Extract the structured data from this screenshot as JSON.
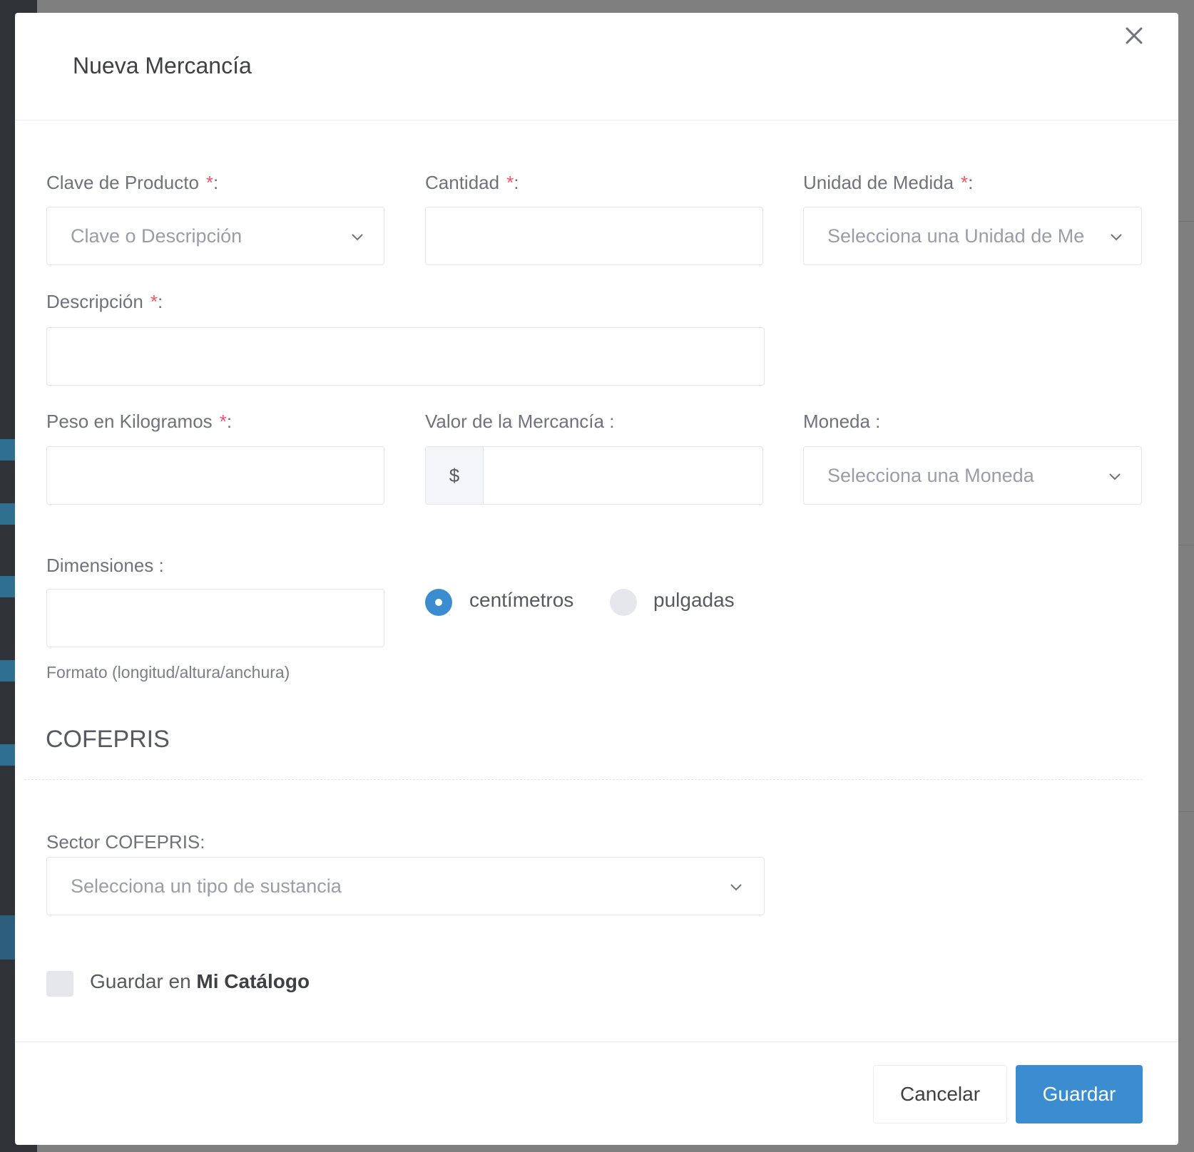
{
  "modal": {
    "title": "Nueva Mercancía",
    "close_icon": "close-icon"
  },
  "form": {
    "clave_producto": {
      "label": "Clave de Producto",
      "required": "*",
      "colon": ":",
      "placeholder": "Clave o Descripción"
    },
    "cantidad": {
      "label": "Cantidad",
      "required": "*",
      "colon": ":",
      "value": ""
    },
    "unidad_medida": {
      "label": "Unidad de Medida",
      "required": "*",
      "colon": ":",
      "placeholder": "Selecciona una Unidad de Me"
    },
    "descripcion": {
      "label": "Descripción",
      "required": "*",
      "colon": ":",
      "value": ""
    },
    "peso": {
      "label": "Peso en Kilogramos",
      "required": "*",
      "colon": ":",
      "value": ""
    },
    "valor": {
      "label": "Valor de la Mercancía :",
      "prefix": "$",
      "value": ""
    },
    "moneda": {
      "label": "Moneda :",
      "placeholder": "Selecciona una Moneda"
    },
    "dimensiones": {
      "label": "Dimensiones :",
      "value": "",
      "help": "Formato (longitud/altura/anchura)"
    },
    "units": {
      "option_cm": "centímetros",
      "option_in": "pulgadas",
      "selected": "centímetros"
    }
  },
  "cofepris": {
    "section_title": "COFEPRIS",
    "sector_label": "Sector COFEPRIS:",
    "sector_placeholder": "Selecciona un tipo de sustancia"
  },
  "catalog": {
    "label_prefix": "Guardar en",
    "label_bold": "Mi Catálogo",
    "checked": false
  },
  "footer": {
    "cancel_label": "Cancelar",
    "save_label": "Guardar"
  },
  "colors": {
    "primary": "#3b8dd0",
    "required": "#f4516c",
    "border": "#e3e5ec"
  }
}
